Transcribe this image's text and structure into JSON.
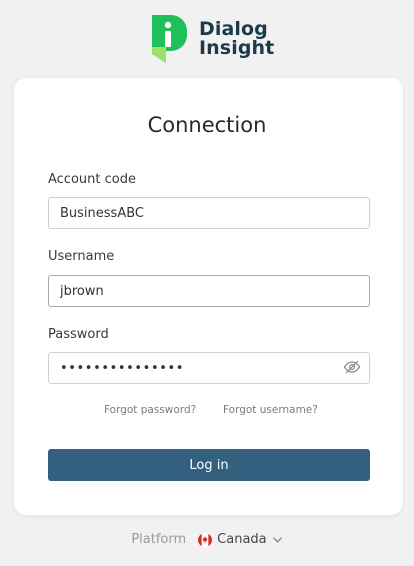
{
  "brand": {
    "name_line1": "Dialog",
    "name_line2": "Insight"
  },
  "form": {
    "title": "Connection",
    "account_code": {
      "label": "Account code",
      "value": "BusinessABC"
    },
    "username": {
      "label": "Username",
      "value": "jbrown"
    },
    "password": {
      "label": "Password",
      "masked_value": "•••••••••••••••"
    },
    "forgot_password": "Forgot password?",
    "forgot_username": "Forgot username?",
    "submit_label": "Log in"
  },
  "footer": {
    "platform_label": "Platform",
    "region": "Canada"
  },
  "colors": {
    "brand_green": "#22c35e",
    "brand_navy": "#1c3a4a",
    "button": "#34607f"
  }
}
